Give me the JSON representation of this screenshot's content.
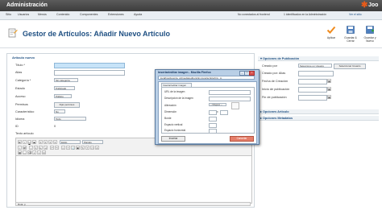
{
  "header": {
    "title": "Administración",
    "logo_text": "Joo"
  },
  "menu": {
    "items": [
      "Sitio",
      "Usuarios",
      "Menús",
      "Contenido",
      "Componentes",
      "Extensiones",
      "Ayuda"
    ],
    "status_left": "No conectados al frontend",
    "status_mid": "1 identificados en la Administración",
    "status_right": "Ver el sitio"
  },
  "toolbar": {
    "page_title": "Gestor de Artículos: Añadir Nuevo Artículo",
    "buttons": [
      "Aplicar",
      "Guardar & Cerrar",
      "Guardar y Nuevo"
    ]
  },
  "form": {
    "legend": "Artículo nuevo",
    "labels": {
      "title": "Título *",
      "alias": "Alias",
      "category": "Categoría *",
      "status": "Estado",
      "access": "Acceso",
      "permissions": "Permisos",
      "featured": "Característico",
      "language": "Idioma",
      "id": "ID",
      "article_text": "Texto artículo"
    },
    "values": {
      "category": "Sin categoría",
      "status": "Publicado",
      "access": "Público",
      "permissions_button": "Fijar permisos",
      "featured": "No",
      "language": "Todo",
      "id": "0"
    },
    "editor": {
      "style_select": "Estilo",
      "paragraph_select": "Párrafo",
      "status_path": "Ruta: p"
    }
  },
  "right_panel": {
    "publishing_head": "Opciones de Publicación",
    "labels": {
      "created_by": "Creado por",
      "created_alias": "Creado por: Alias",
      "created_date": "Fecha de Creación",
      "publish_up": "Inicio de publicación",
      "publish_down": "Fin de publicación"
    },
    "created_by_value": "Seleccione un Usuario",
    "select_user_button": "Seleccionar Usuario",
    "article_options": "Opciones Artículo",
    "metadata_options": "Opciones Metadatos"
  },
  "modal": {
    "window_title": "Insertar/editar imagen - Mozilla Firefox",
    "url": "localhost/joomla_cd/media/editors/tinymce/jscripts/tiny_m",
    "tab": "Insertar/editar imagen",
    "labels": {
      "image_url": "URL de la imagen",
      "description": "Descripción de la imagen",
      "alignment": "Alineación",
      "dimensions": "Dimensión",
      "border": "Borde",
      "vspace": "Espacio vertical",
      "hspace": "Espacio horizontal"
    },
    "alignment_value": "-- Ninguno --",
    "dimension_x": "x",
    "insert_button": "Insertar",
    "cancel_button": "Cancelar"
  }
}
